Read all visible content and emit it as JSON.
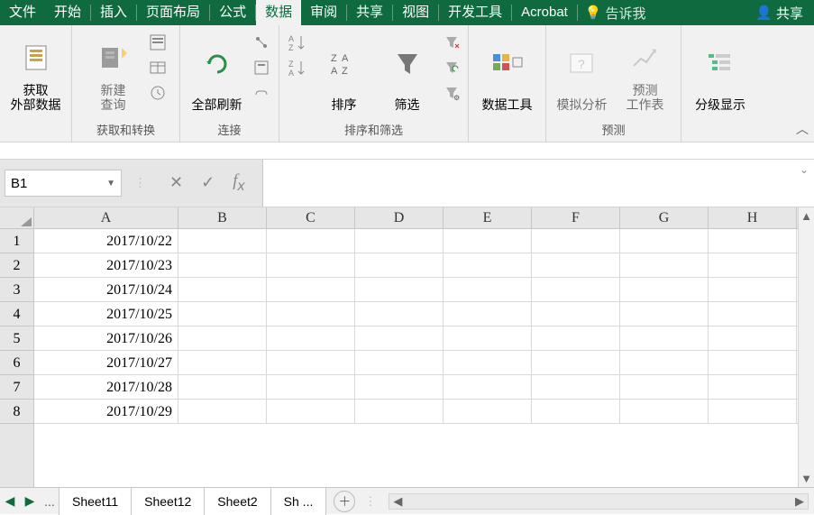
{
  "menu": {
    "file": "文件",
    "home": "开始",
    "insert": "插入",
    "layout": "页面布局",
    "formula": "公式",
    "data": "数据",
    "review": "审阅",
    "share": "共享",
    "view": "视图",
    "dev": "开发工具",
    "acrobat": "Acrobat",
    "tellme": "告诉我",
    "sharebtn": "共享"
  },
  "ribbon": {
    "get_external": "获取\n外部数据",
    "new_query": "新建\n查询",
    "refresh_all": "全部刷新",
    "sort": "排序",
    "filter": "筛选",
    "data_tools": "数据工具",
    "whatif": "模拟分析",
    "forecast": "预测\n工作表",
    "outline": "分级显示",
    "grp_get_transform": "获取和转换",
    "grp_connections": "连接",
    "grp_sort_filter": "排序和筛选",
    "grp_forecast": "预测"
  },
  "namebox": "B1",
  "columns": [
    "A",
    "B",
    "C",
    "D",
    "E",
    "F",
    "G",
    "H"
  ],
  "rows": [
    {
      "n": "1",
      "A": "2017/10/22"
    },
    {
      "n": "2",
      "A": "2017/10/23"
    },
    {
      "n": "3",
      "A": "2017/10/24"
    },
    {
      "n": "4",
      "A": "2017/10/25"
    },
    {
      "n": "5",
      "A": "2017/10/26"
    },
    {
      "n": "6",
      "A": "2017/10/27"
    },
    {
      "n": "7",
      "A": "2017/10/28"
    },
    {
      "n": "8",
      "A": "2017/10/29"
    }
  ],
  "sheets": [
    "Sheet11",
    "Sheet12",
    "Sheet2",
    "Sh ..."
  ]
}
